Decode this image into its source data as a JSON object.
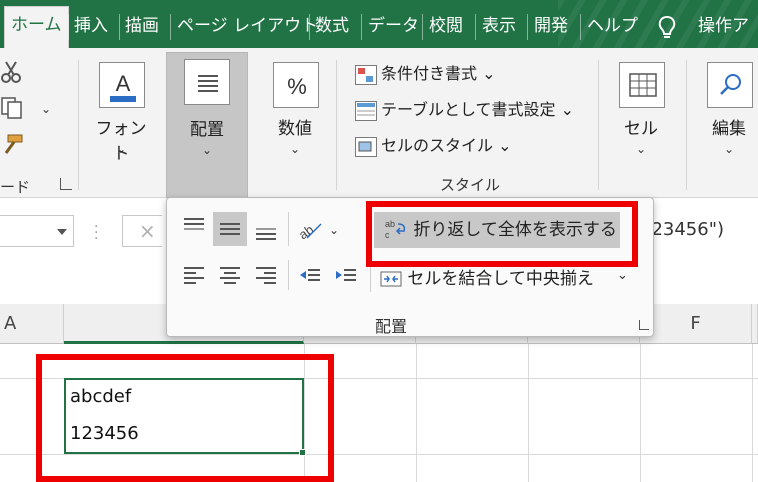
{
  "tabs": [
    "ホーム",
    "挿入",
    "描画",
    "ページ レイアウト",
    "数式",
    "データ",
    "校閲",
    "表示",
    "開発",
    "ヘルプ"
  ],
  "tell_me": "操作アシ",
  "ribbon": {
    "clipboard_partial": "ード",
    "font_label": "フォント",
    "align_label": "配置",
    "number_label": "数値",
    "cond_format": "条件付き書式",
    "table_format": "テーブルとして書式設定",
    "cell_styles": "セルのスタイル",
    "styles_group": "スタイル",
    "cells_label": "セル",
    "edit_label": "編集"
  },
  "formula_bar": {
    "content_partial": "123456\")"
  },
  "columns": {
    "a": "A",
    "f": "F"
  },
  "cell": {
    "line1": "abcdef",
    "line2": "123456"
  },
  "dropdown": {
    "wrap_text": "折り返して全体を表示する",
    "merge_center": "セルを結合して中央揃え",
    "group_label": "配置"
  },
  "colors": {
    "excel_green": "#217346",
    "highlight_red": "#ee0000"
  }
}
